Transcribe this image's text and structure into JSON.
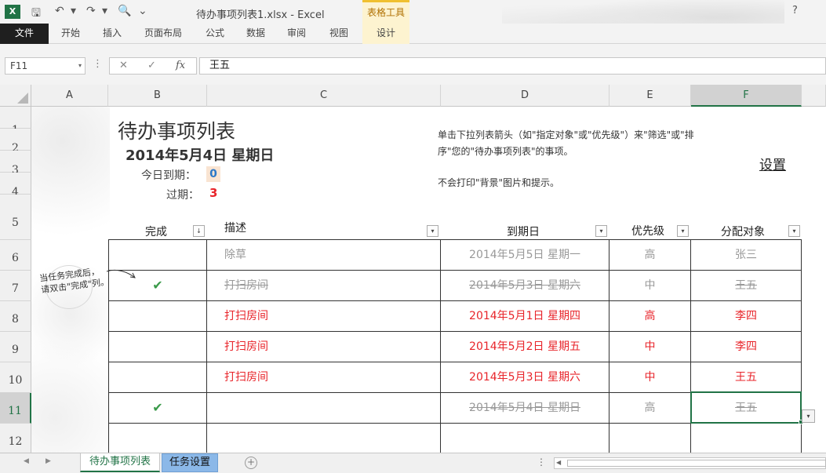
{
  "window": {
    "title": "待办事项列表1.xlsx - Excel",
    "help": "?",
    "contextual_tab_group": "表格工具"
  },
  "quick_access": {
    "save": "🖫",
    "undo": "↶",
    "redo": "↷",
    "preview": "🔍",
    "dropdown": "▾",
    "customize": "⌄"
  },
  "ribbon": {
    "tabs": [
      "文件",
      "开始",
      "插入",
      "页面布局",
      "公式",
      "数据",
      "审阅",
      "视图",
      "设计"
    ],
    "active_contextual": "设计"
  },
  "formula_bar": {
    "name_box": "F11",
    "cancel": "✕",
    "enter": "✓",
    "fx": "fx",
    "content": "王五"
  },
  "grid": {
    "columns": [
      "A",
      "B",
      "C",
      "D",
      "E",
      "F"
    ],
    "rows": [
      "1",
      "2",
      "3",
      "4",
      "5",
      "6",
      "7",
      "8",
      "9",
      "10",
      "11",
      "12"
    ],
    "selected_column": "F",
    "selected_row": "11"
  },
  "sheet": {
    "title": "待办事项列表",
    "date": "2014年5月4日 星期日",
    "today_label": "今日到期：",
    "today_count": "0",
    "overdue_label": "过期：",
    "overdue_count": "3",
    "note_line1": "单击下拉列表箭头（如\"指定对象\"或\"优先级\"）来\"筛选\"或\"排",
    "note_line2": "序\"您的\"待办事项列表\"的事项。",
    "note_line3": "不会打印\"背景\"图片和提示。",
    "settings_link": "设置",
    "hint_line1": "当任务完成后，",
    "hint_line2": "请双击\"完成\"列。"
  },
  "table": {
    "headers": {
      "done": "完成",
      "description": "描述",
      "due": "到期日",
      "priority": "优先级",
      "assignee": "分配对象"
    },
    "filter_glyph": "▾",
    "sort_glyph": "↓",
    "rows": [
      {
        "done": "",
        "description": "除草",
        "due": "2014年5月5日 星期一",
        "priority": "高",
        "assignee": "张三",
        "style": "gray"
      },
      {
        "done": "✔",
        "description": "打扫房间",
        "due": "2014年5月3日 星期六",
        "priority": "中",
        "assignee": "王五",
        "style": "done"
      },
      {
        "done": "",
        "description": "打扫房间",
        "due": "2014年5月1日 星期四",
        "priority": "高",
        "assignee": "李四",
        "style": "red"
      },
      {
        "done": "",
        "description": "打扫房间",
        "due": "2014年5月2日 星期五",
        "priority": "中",
        "assignee": "李四",
        "style": "red"
      },
      {
        "done": "",
        "description": "打扫房间",
        "due": "2014年5月3日 星期六",
        "priority": "中",
        "assignee": "王五",
        "style": "red"
      },
      {
        "done": "✔",
        "description": "",
        "due": "2014年5月4日 星期日",
        "priority": "高",
        "assignee": "王五",
        "style": "done"
      },
      {
        "done": "",
        "description": "",
        "due": "",
        "priority": "",
        "assignee": "",
        "style": "gray"
      }
    ]
  },
  "sheet_tabs": {
    "tabs": [
      "待办事项列表",
      "任务设置"
    ],
    "active": "待办事项列表",
    "add": "+",
    "menu": "⋮"
  },
  "colors": {
    "accent": "#217346",
    "overdue_red": "#e8242a",
    "today_blue": "#2b78c8",
    "done_gray": "#999999"
  }
}
